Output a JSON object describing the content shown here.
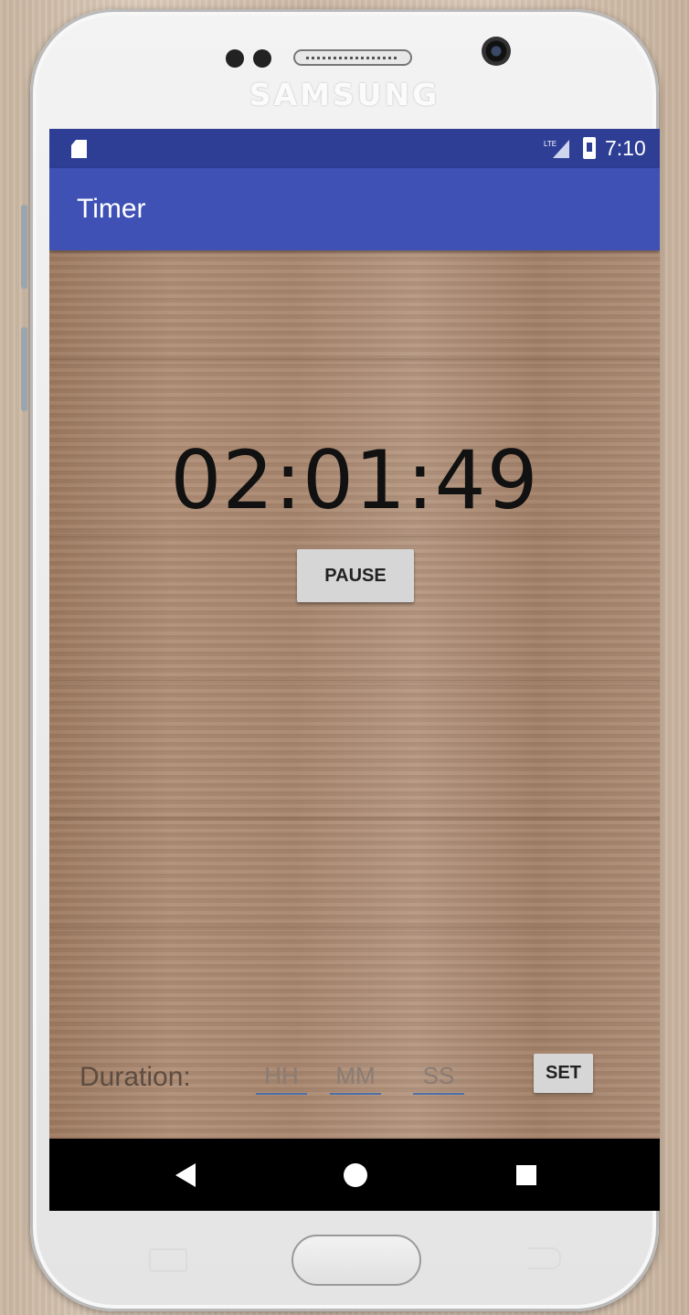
{
  "device": {
    "brand": "SAMSUNG"
  },
  "status_bar": {
    "time": "7:10",
    "background": "#2e3e95"
  },
  "app_bar": {
    "title": "Timer",
    "background": "#3f51b5"
  },
  "timer": {
    "display": "02:01:49"
  },
  "controls": {
    "pause_label": "PAUSE"
  },
  "duration": {
    "label": "Duration:",
    "hours_placeholder": "HH",
    "minutes_placeholder": "MM",
    "seconds_placeholder": "SS",
    "set_label": "SET"
  },
  "nav_bar": {
    "icons": [
      "back-icon",
      "home-icon",
      "recent-apps-icon"
    ]
  }
}
